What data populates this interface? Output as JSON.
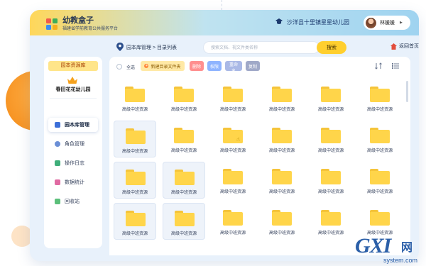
{
  "header": {
    "title": "幼教盒子",
    "subtitle": "福建省学前教育公共服务平台",
    "school": "沙洋县十里镇星星幼儿园",
    "user_name": "林媛媛"
  },
  "breadcrumb": "园本库管理 > 目录列表",
  "search": {
    "placeholder": "搜索文档、视文件类名称",
    "button": "搜索"
  },
  "home_link": "返回首页",
  "sidebar": {
    "repo_label": "园本资源库",
    "kindergarten": "春田花花幼儿园",
    "items": [
      {
        "label": "园本库管理",
        "icon": "folder-icon",
        "active": true
      },
      {
        "label": "角色管理",
        "icon": "person-icon",
        "active": false
      },
      {
        "label": "操作日志",
        "icon": "log-icon",
        "active": false
      },
      {
        "label": "数据统计",
        "icon": "stats-icon",
        "active": false
      },
      {
        "label": "回收站",
        "icon": "trash-icon",
        "active": false
      }
    ]
  },
  "toolbar": {
    "select_all": "全选",
    "new_folder": "新建目录文件夹",
    "delete": "删除",
    "permission": "权限",
    "rename": "重命名",
    "copy": "复制"
  },
  "files": [
    "高级中班资源",
    "高级中班资源",
    "高级中班资源",
    "高级中班资源",
    "高级中班资源",
    "高级中班资源",
    "高级中班资源",
    "高级中班资源",
    "高级中班资源",
    "高级中班资源",
    "高级中班资源",
    "高级中班资源",
    "高级中班资源",
    "高级中班资源",
    "高级中班资源",
    "高级中班资源",
    "高级中班资源",
    "高级中班资源",
    "高级中班资源",
    "高级中班资源",
    "高级中班资源",
    "高级中班资源",
    "高级中班资源",
    "高级中班资源"
  ],
  "watermark": {
    "main": "GXI",
    "net": "网",
    "sub": "system.com"
  },
  "colors": {
    "accent": "#ffcf2e",
    "folder": "#ffd54a",
    "panel": "#e8f1fb",
    "delete": "#ff8f8f",
    "permission": "#8fb4ff"
  }
}
